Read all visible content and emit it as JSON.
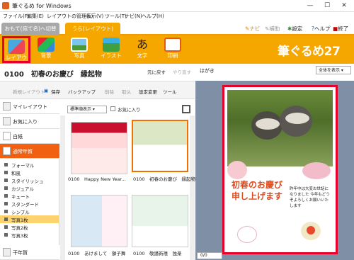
{
  "window": {
    "title": "筆ぐるめ for Windows",
    "minimize": "—",
    "maximize": "☐",
    "close": "✕"
  },
  "menu": [
    "ファイル(F)",
    "編集(E)",
    "レイアウトの管理(L)",
    "表示(V)",
    "ツール(T)",
    "ナビ(N)",
    "ヘルプ(H)"
  ],
  "tabs": {
    "front": "おもて(宛て名)へ切替",
    "back": "うら(レイアウト)"
  },
  "top_links": {
    "navi": "ナビ",
    "hojo": "補助",
    "settings": "設定",
    "help": "ヘルプ",
    "quit": "終了"
  },
  "tools": [
    {
      "label": "レイアウト",
      "icon": "layout-icon"
    },
    {
      "label": "背景",
      "icon": "background-icon"
    },
    {
      "label": "写真",
      "icon": "photo-icon"
    },
    {
      "label": "イラスト",
      "icon": "illustration-icon"
    },
    {
      "label": "文字",
      "icon": "text-icon"
    },
    {
      "label": "印刷",
      "icon": "print-icon"
    }
  ],
  "brand": "筆ぐるめ27",
  "document": {
    "title": "0100　初春のお慶び　縁起物",
    "undo": "元に戻す",
    "redo": "やり直す"
  },
  "toolbar": {
    "new_layout": "新規レイアウト",
    "save": "保存",
    "backup": "バックアップ",
    "delete": "削除",
    "export": "取込",
    "settings": "設定変更",
    "tools": "ツール"
  },
  "sidebar": {
    "my_layout": "マイレイアウト",
    "favorites": "お気に入り",
    "blank": "白紙",
    "normal_nengajo": "通常年賀",
    "subitems": [
      "フォーマル",
      "和風",
      "スタイリッシュ",
      "カジュアル",
      "キュート",
      "スタンダード",
      "シンプル",
      "写真1枚",
      "写真2枚",
      "写真3枚"
    ],
    "selected_sub": "写真1枚",
    "eto_nenga": "干年賀"
  },
  "gallery": {
    "sort": "標準順表示",
    "fav_label": "お気に入り",
    "items": [
      {
        "caption": "0100　Happy New Year..."
      },
      {
        "caption": "0100　初春のお慶び　縁起物"
      },
      {
        "caption": "0100　あけまして　獅子舞"
      },
      {
        "caption": "0100　敬謹新禧　独楽"
      }
    ]
  },
  "preview": {
    "label": "はがき",
    "zoom": "全体を表示",
    "page": "0/0"
  },
  "card": {
    "greeting": "初春のお慶び申し上げます",
    "body": "昨年中は大変お世話になりました 今年もどうぞよろしくお願いいたします"
  },
  "colors": {
    "accent": "#f5a700",
    "selected": "#e8002a",
    "sidebar_active": "#f06010"
  }
}
